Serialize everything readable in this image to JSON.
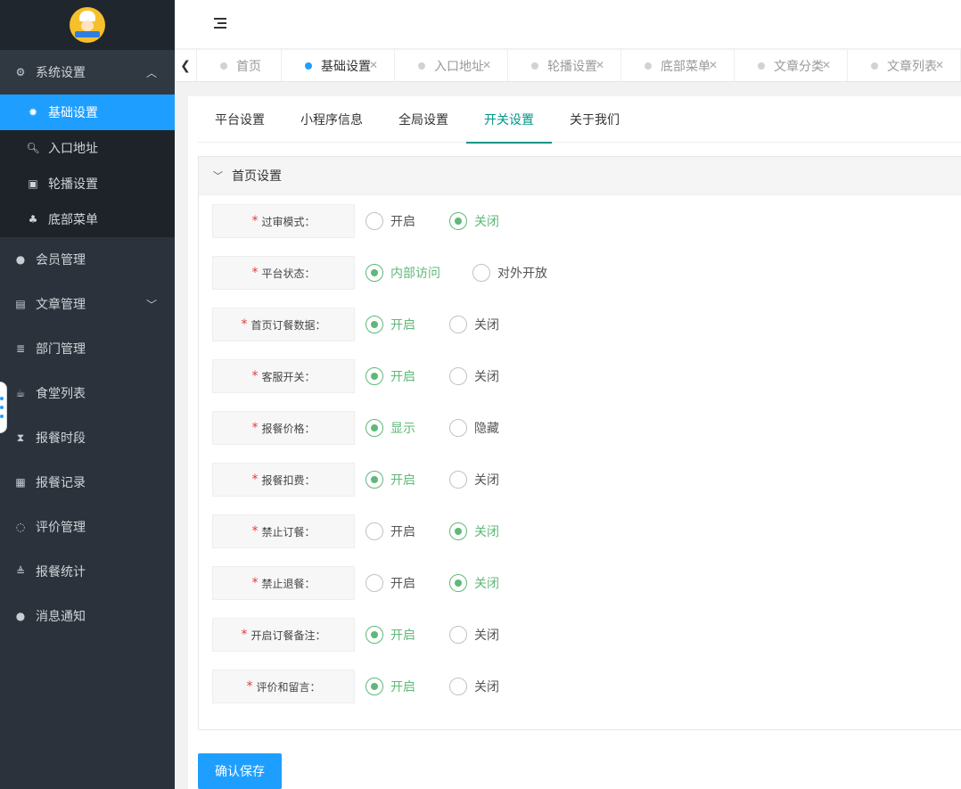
{
  "sidebar": {
    "items": [
      {
        "label": "系统设置",
        "icon": "gears-icon"
      },
      {
        "label": "会员管理",
        "icon": "user-icon"
      },
      {
        "label": "文章管理",
        "icon": "newspaper-icon"
      },
      {
        "label": "部门管理",
        "icon": "list-icon"
      },
      {
        "label": "食堂列表",
        "icon": "cup-icon"
      },
      {
        "label": "报餐时段",
        "icon": "hourglass-icon"
      },
      {
        "label": "报餐记录",
        "icon": "table-icon"
      },
      {
        "label": "评价管理",
        "icon": "comment-icon"
      },
      {
        "label": "报餐统计",
        "icon": "align-icon"
      },
      {
        "label": "消息通知",
        "icon": "chat-icon"
      }
    ],
    "sub_items": [
      {
        "label": "基础设置",
        "icon": "gear-icon"
      },
      {
        "label": "入口地址",
        "icon": "search-icon"
      },
      {
        "label": "轮播设置",
        "icon": "image-icon"
      },
      {
        "label": "底部菜单",
        "icon": "sitemap-icon"
      }
    ]
  },
  "tabs": [
    {
      "label": "首页"
    },
    {
      "label": "基础设置"
    },
    {
      "label": "入口地址"
    },
    {
      "label": "轮播设置"
    },
    {
      "label": "底部菜单"
    },
    {
      "label": "文章分类"
    },
    {
      "label": "文章列表"
    }
  ],
  "subtabs": [
    "平台设置",
    "小程序信息",
    "全局设置",
    "开关设置",
    "关于我们"
  ],
  "panel": {
    "title": "首页设置"
  },
  "settings": [
    {
      "label": "过审模式：",
      "options": [
        "开启",
        "关闭"
      ],
      "selected": 1
    },
    {
      "label": "平台状态：",
      "options": [
        "内部访问",
        "对外开放"
      ],
      "selected": 0
    },
    {
      "label": "首页订餐数据：",
      "options": [
        "开启",
        "关闭"
      ],
      "selected": 0
    },
    {
      "label": "客服开关：",
      "options": [
        "开启",
        "关闭"
      ],
      "selected": 0
    },
    {
      "label": "报餐价格：",
      "options": [
        "显示",
        "隐藏"
      ],
      "selected": 0
    },
    {
      "label": "报餐扣费：",
      "options": [
        "开启",
        "关闭"
      ],
      "selected": 0
    },
    {
      "label": "禁止订餐：",
      "options": [
        "开启",
        "关闭"
      ],
      "selected": 1
    },
    {
      "label": "禁止退餐：",
      "options": [
        "开启",
        "关闭"
      ],
      "selected": 1
    },
    {
      "label": "开启订餐备注：",
      "options": [
        "开启",
        "关闭"
      ],
      "selected": 0
    },
    {
      "label": "评价和留言：",
      "options": [
        "开启",
        "关闭"
      ],
      "selected": 0
    }
  ],
  "required_mark": "*",
  "save_label": "确认保存",
  "colors": {
    "accent": "#1e9fff",
    "radio_on": "#5fb878",
    "tab_active": "#009688",
    "sidebar": "#2b323b"
  }
}
